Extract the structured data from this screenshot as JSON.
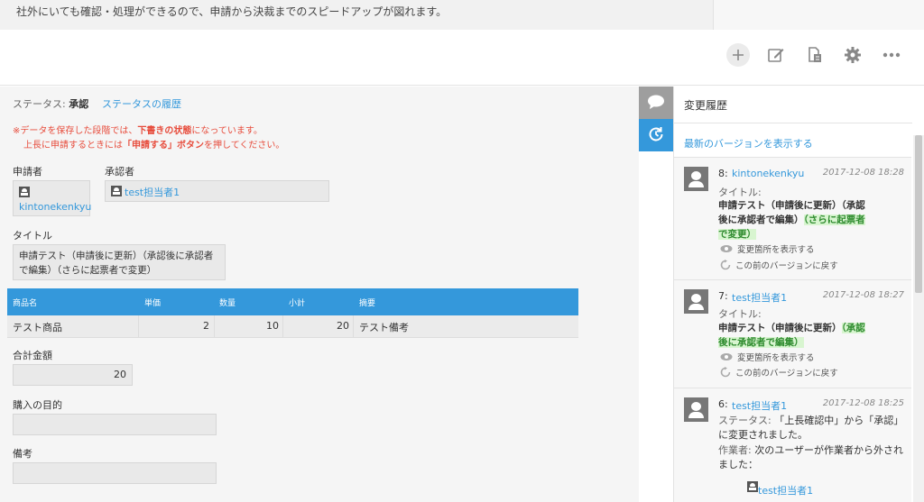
{
  "banner": {
    "text": "社外にいても確認・処理ができるので、申請から決裁までのスピードアップが図れます。"
  },
  "toolbar": {
    "icons": [
      "plus-icon",
      "edit-icon",
      "copy-icon",
      "gear-icon",
      "more-icon"
    ]
  },
  "record": {
    "status_label": "ステータス:",
    "status_value": "承認",
    "status_history_link": "ステータスの履歴",
    "notice_line1_a": "※データを保存した段階では、",
    "notice_line1_b": "下書きの状態",
    "notice_line1_c": "になっています。",
    "notice_line2_a": "上長に申請するときには",
    "notice_line2_b": "「申請する」ボタン",
    "notice_line2_c": "を押してください。",
    "applicant_label": "申請者",
    "applicant_value": "kintonekenkyu",
    "approver_label": "承認者",
    "approver_value": "test担当者1",
    "title_label": "タイトル",
    "title_line1": "申請テスト（申請後に更新）（承認後に承認者",
    "title_line2": "で編集）（さらに起票者で変更）",
    "table": {
      "headers": [
        "商品名",
        "単価",
        "数量",
        "小計",
        "摘要"
      ],
      "rows": [
        [
          "テスト商品",
          "2",
          "10",
          "20",
          "テスト備考"
        ]
      ]
    },
    "total_label": "合計金額",
    "total_value": "20",
    "purpose_label": "購入の目的",
    "purpose_value": "",
    "remarks_label": "備考",
    "remarks_value": ""
  },
  "history": {
    "title": "変更履歴",
    "latest_link": "最新のバージョンを表示する",
    "show_changes": "変更箇所を表示する",
    "revert": "この前のバージョンに戻す",
    "entries": [
      {
        "num": "8:",
        "user": "kintonekenkyu",
        "date": "2017-12-08 18:28",
        "field": "タイトル:",
        "line1": "申請テスト（申請後に更新）（承認",
        "line2a": "後に承認者で編集）",
        "line2b": "（さらに起票者",
        "line3": "で変更）"
      },
      {
        "num": "7:",
        "user": "test担当者1",
        "date": "2017-12-08 18:27",
        "field": "タイトル:",
        "line1a": "申請テスト（申請後に更新）",
        "line1b": "（承認",
        "line2": "後に承認者で編集）"
      },
      {
        "num": "6:",
        "user": "test担当者1",
        "date": "2017-12-08 18:25",
        "status_label": "ステータス:",
        "status_text": "「上長確認中」から「承認」",
        "status_text2": "に変更されました。",
        "worker_label": "作業者:",
        "worker_text": "次のユーザーが作業者から外され",
        "worker_text2": "ました：",
        "worker_user": "test担当者1"
      }
    ]
  }
}
